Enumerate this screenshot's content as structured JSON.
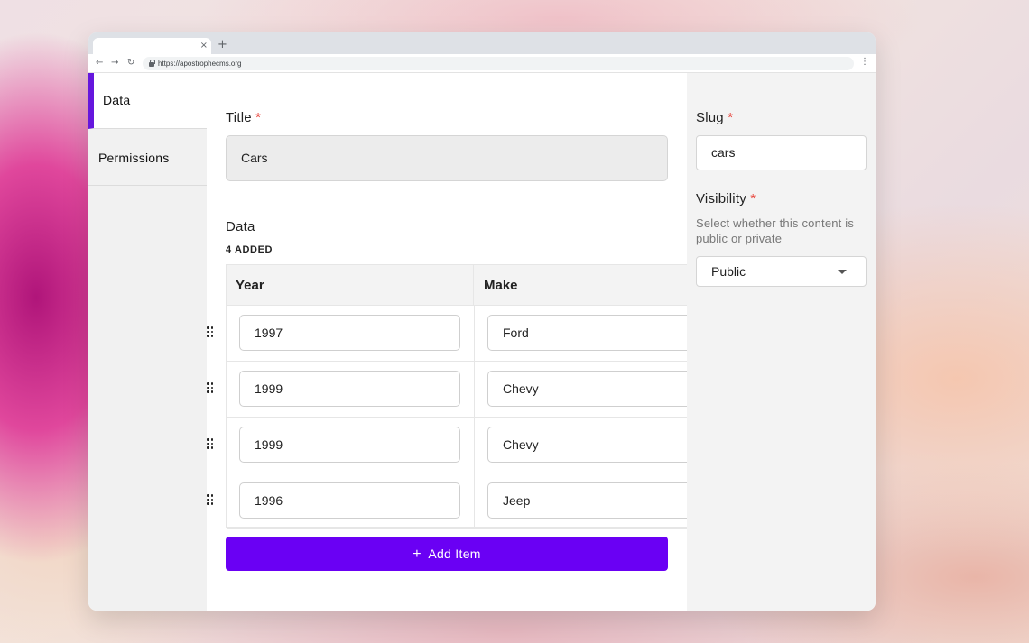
{
  "browser": {
    "url": "https://apostrophecms.org",
    "tab_close": "×",
    "new_tab": "+",
    "back": "←",
    "forward": "→",
    "reload": "↻",
    "menu": "⋮"
  },
  "sidebar": {
    "items": [
      {
        "label": "Data",
        "active": true
      },
      {
        "label": "Permissions",
        "active": false
      }
    ]
  },
  "form": {
    "title_label": "Title",
    "required_mark": "*",
    "title_value": "Cars",
    "data_label": "Data",
    "added_count": "4 ADDED",
    "columns": [
      "Year",
      "Make"
    ],
    "rows": [
      {
        "year": "1997",
        "make": "Ford"
      },
      {
        "year": "1999",
        "make": "Chevy"
      },
      {
        "year": "1999",
        "make": "Chevy"
      },
      {
        "year": "1996",
        "make": "Jeep"
      }
    ],
    "add_item_label": "Add Item",
    "add_item_icon": "+"
  },
  "side": {
    "slug_label": "Slug",
    "slug_value": "cars",
    "visibility_label": "Visibility",
    "visibility_help": "Select whether this content is public or private",
    "visibility_value": "Public"
  },
  "colors": {
    "accent": "#6a00f4",
    "active_indicator": "#6516dd",
    "required": "#e8433a"
  }
}
